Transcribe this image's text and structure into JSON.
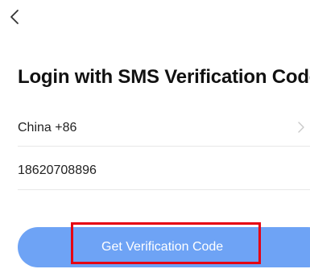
{
  "header": {
    "back_icon": "chevron-left-icon"
  },
  "title": "Login with SMS Verification Code",
  "country": {
    "label": "China +86",
    "chevron_icon": "chevron-right-icon"
  },
  "phone": {
    "value": "18620708896"
  },
  "cta": {
    "label": "Get Verification Code"
  },
  "colors": {
    "button": "#6ea3f5",
    "highlight": "#e60012",
    "divider": "#e8e8e8"
  }
}
